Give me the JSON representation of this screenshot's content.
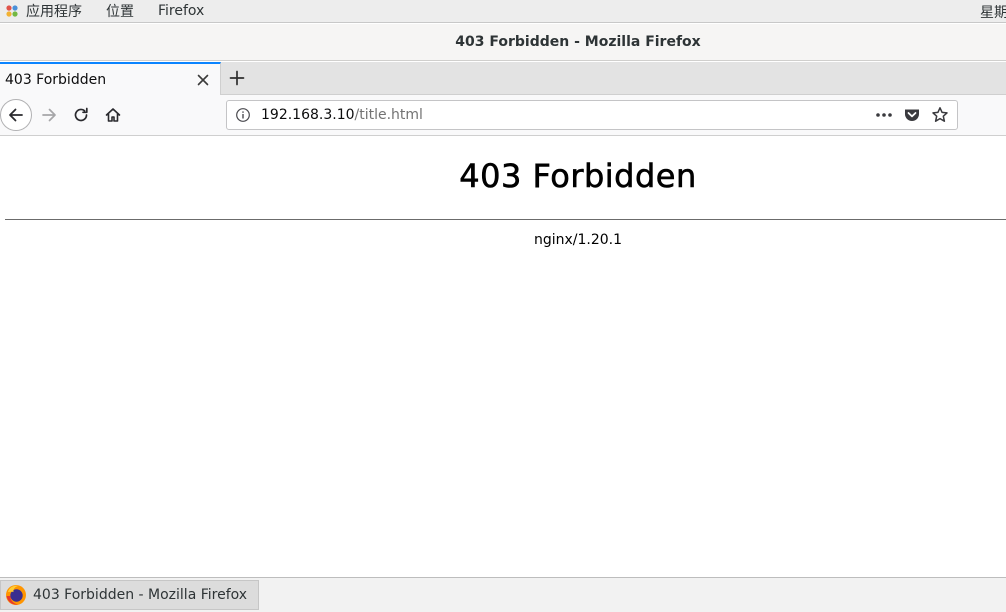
{
  "topbar": {
    "apps_label": "应用程序",
    "places_label": "位置",
    "firefox_label": "Firefox",
    "clock_text": "星期"
  },
  "window": {
    "title": "403 Forbidden - Mozilla Firefox"
  },
  "tabs": [
    {
      "label": "403 Forbidden",
      "active": true
    }
  ],
  "urlbar": {
    "host": "192.168.3.10",
    "path": "/title.html"
  },
  "page": {
    "heading": "403 Forbidden",
    "server": "nginx/1.20.1"
  },
  "taskbar": {
    "item_label": "403 Forbidden - Mozilla Firefox"
  },
  "colors": {
    "tab_accent": "#0a84ff",
    "firefox_orange": "#ff9500"
  }
}
